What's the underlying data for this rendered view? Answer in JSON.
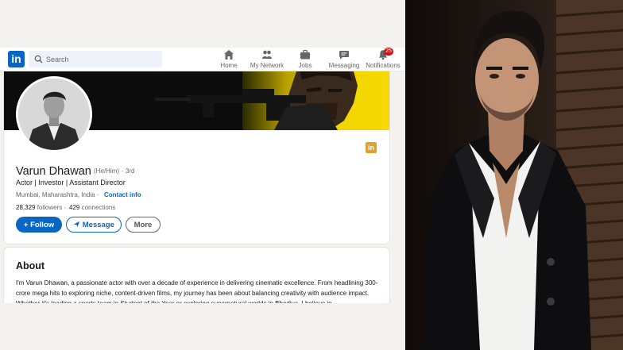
{
  "brand": {
    "logo_text": "in",
    "color": "#0a66c2"
  },
  "search": {
    "placeholder": "Search"
  },
  "nav": [
    {
      "label": "Home",
      "icon": "home-icon"
    },
    {
      "label": "My Network",
      "icon": "network-icon"
    },
    {
      "label": "Jobs",
      "icon": "briefcase-icon"
    },
    {
      "label": "Messaging",
      "icon": "messaging-icon"
    },
    {
      "label": "Notifications",
      "icon": "bell-icon",
      "badge": "25"
    }
  ],
  "profile": {
    "name": "Varun Dhawan",
    "pronouns": "(He/Him)",
    "degree": "· 3rd",
    "headline": "Actor | Investor | Assistant Director",
    "location": "Mumbai, Maharashtra, India ·",
    "contact_info": "Contact info",
    "followers_count": "28,329",
    "followers_label": "followers ·",
    "connections_count": "429",
    "connections_label": "connections",
    "follow_label": "Follow",
    "message_label": "Message",
    "more_label": "More"
  },
  "about": {
    "title": "About",
    "text": "I'm Varun Dhawan, a passionate actor with over a decade of experience in delivering cinematic excellence. From headlining 300-crore mega hits to exploring niche, content-driven films, my journey has been about balancing creativity with audience impact. Whether it's leading a sports team in Student of the Year or exploring supernatural worlds in Bhediya, I believe in"
  },
  "colors": {
    "accent": "#0a66c2",
    "badge": "#cc1016",
    "page_bg": "#f3f2ef"
  }
}
